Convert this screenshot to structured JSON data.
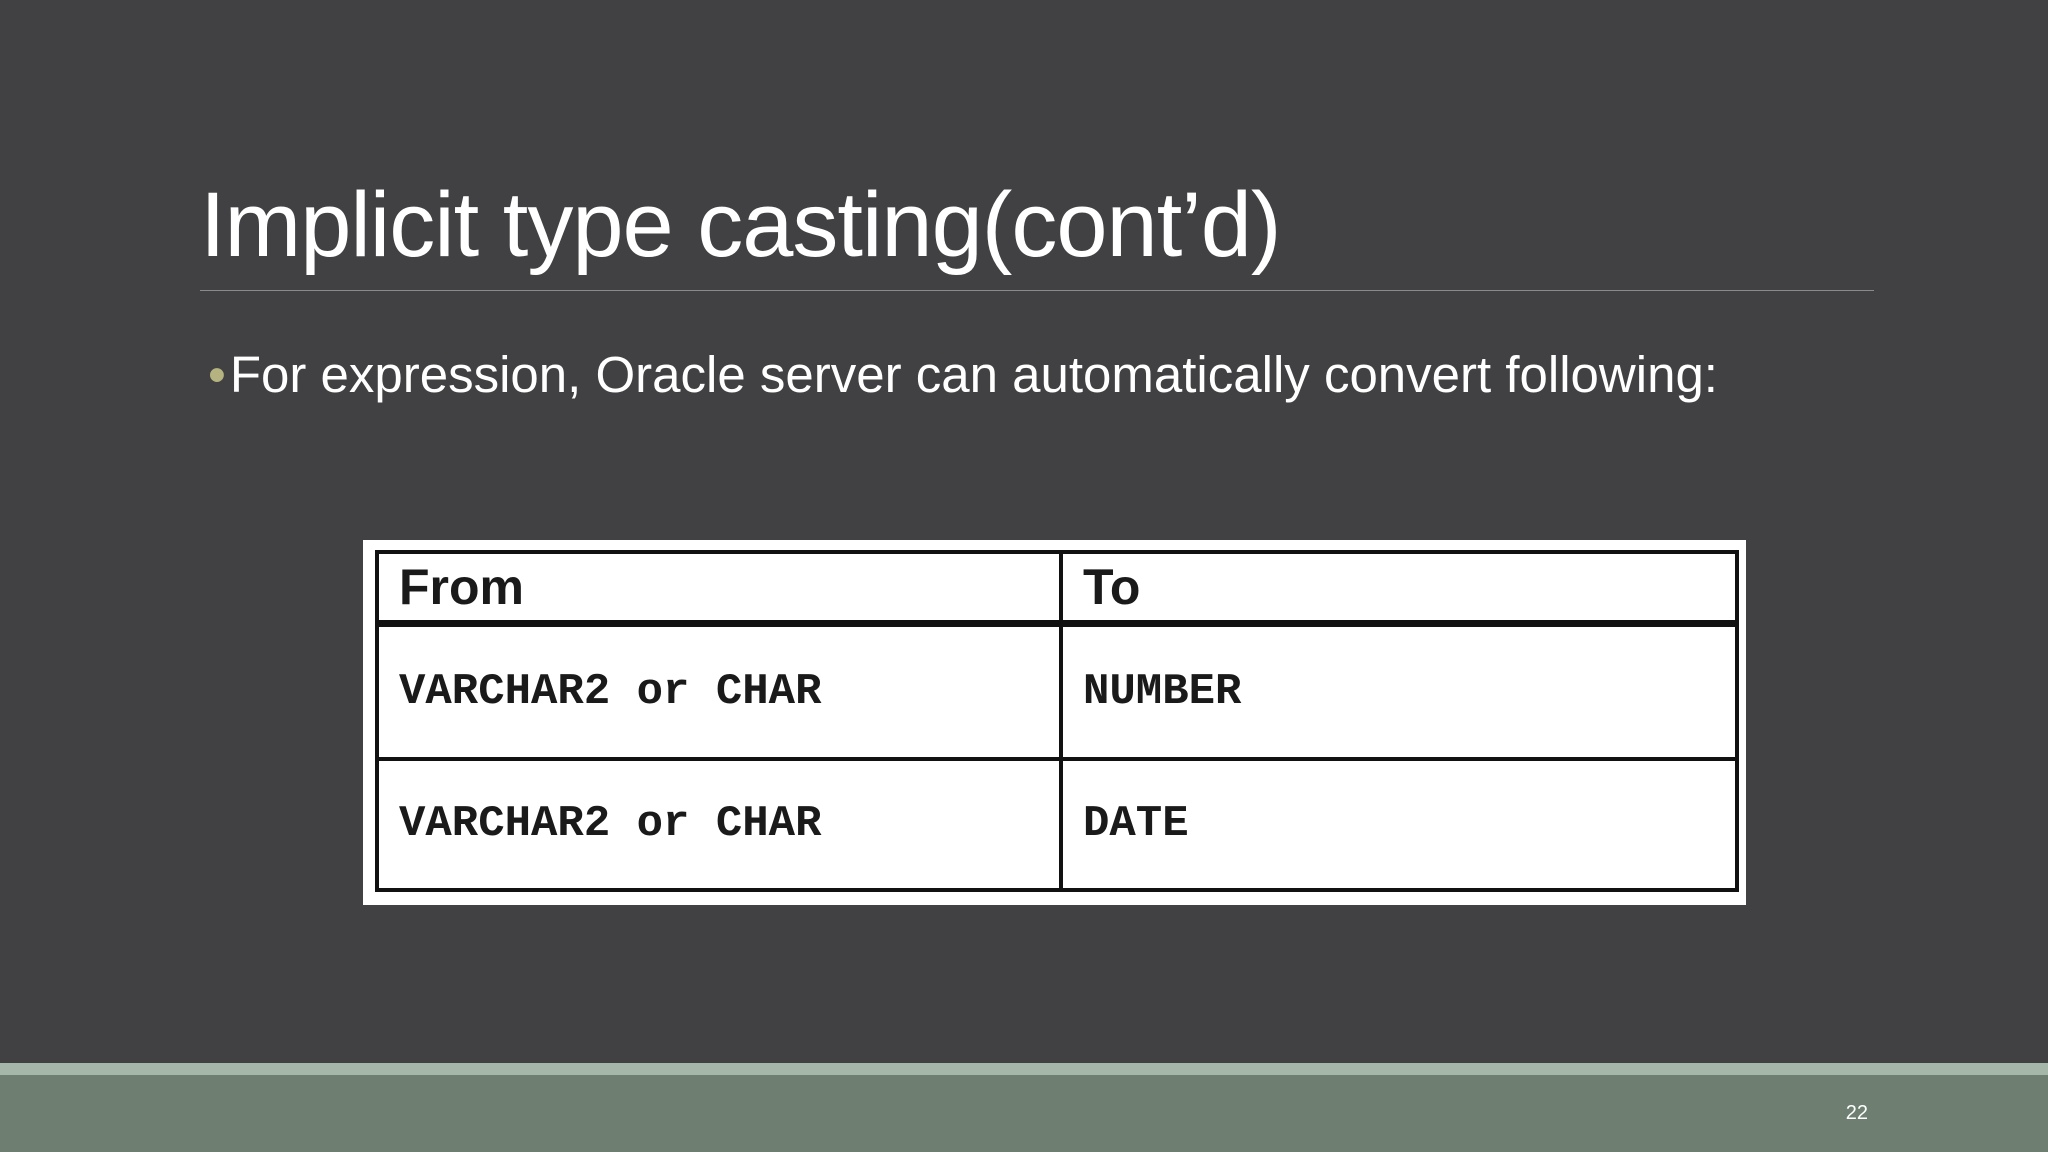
{
  "slide": {
    "title": "Implicit type casting(cont’d)",
    "bullet_marker": "•",
    "bullet_text": "For expression, Oracle server can automatically convert following:",
    "page_number": "22"
  },
  "table": {
    "headers": [
      "From",
      "To"
    ],
    "rows": [
      [
        "VARCHAR2 or CHAR",
        "NUMBER"
      ],
      [
        "VARCHAR2 or CHAR",
        "DATE"
      ]
    ]
  },
  "colors": {
    "background": "#414042",
    "bullet_accent": "#b5b380",
    "footer_band": "#6e7f72",
    "footer_stripe": "#a4b7a9"
  }
}
